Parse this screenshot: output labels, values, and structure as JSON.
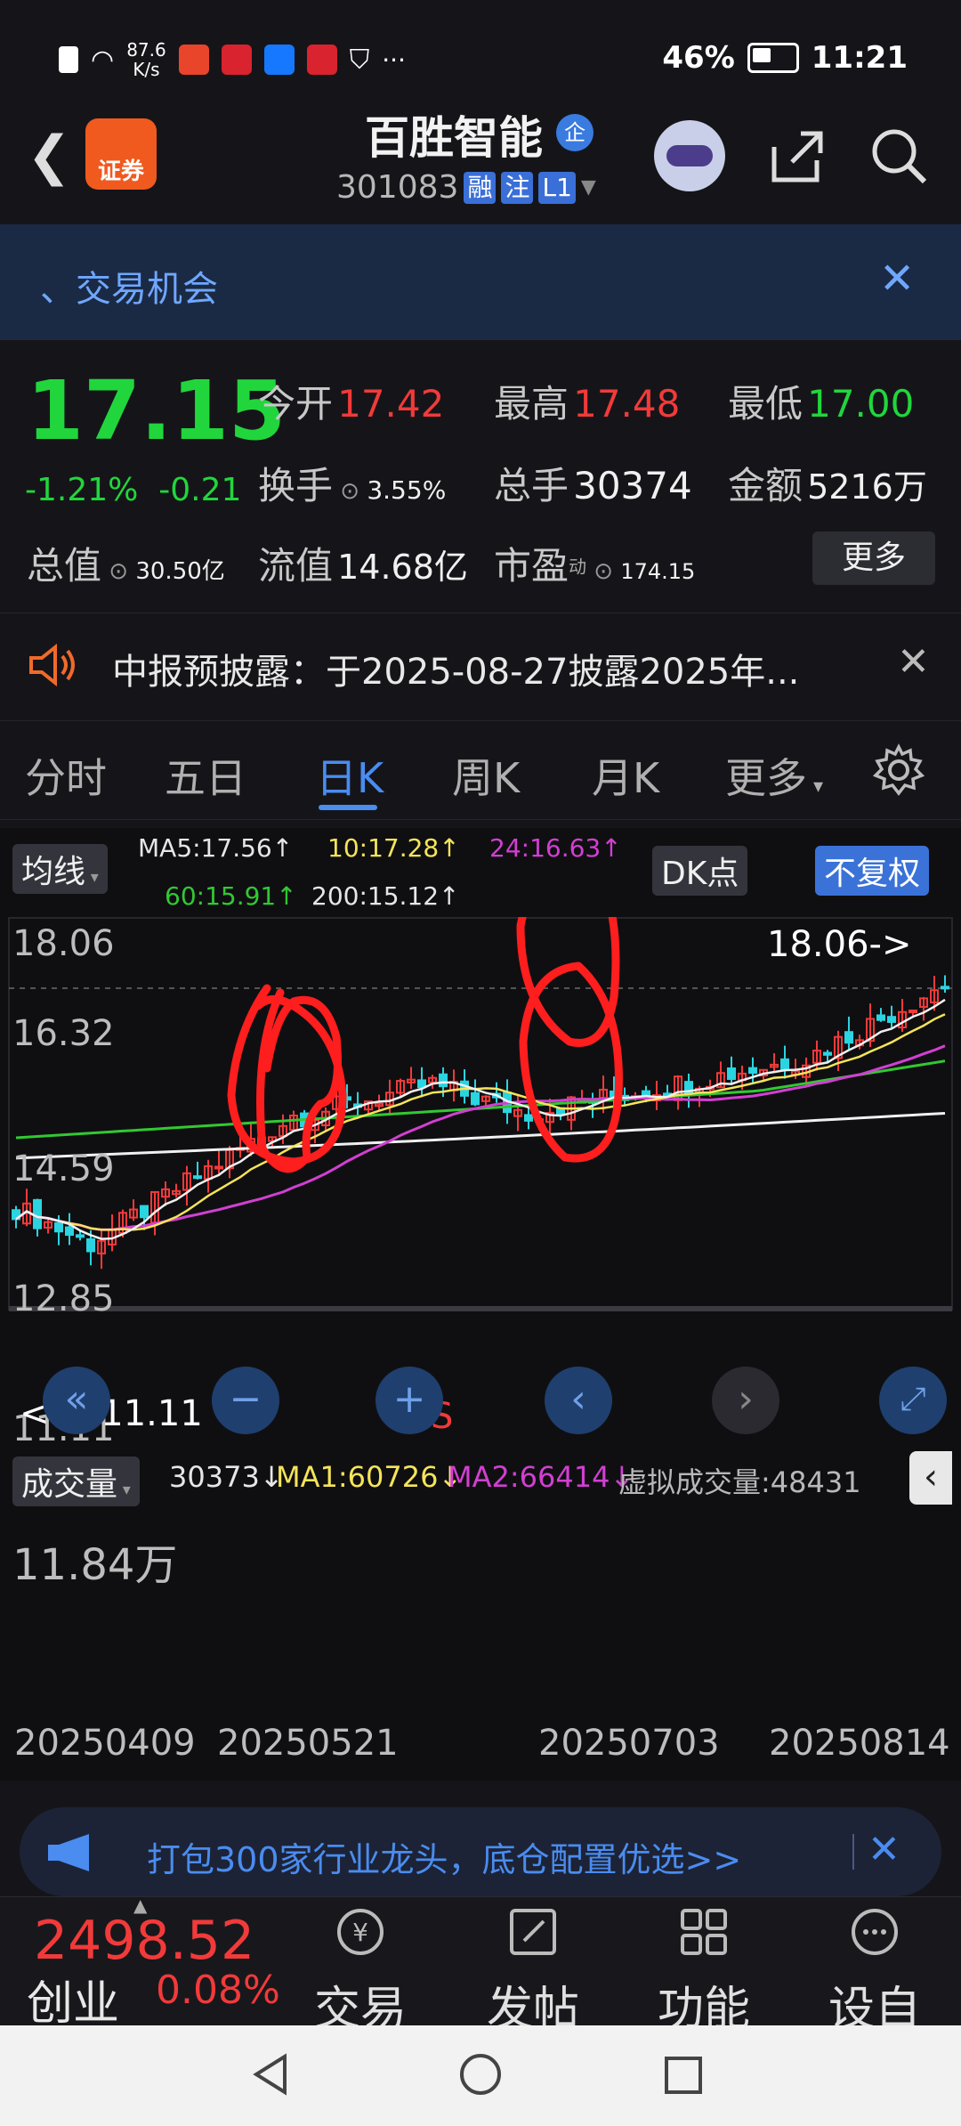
{
  "status_bar": {
    "net_speed": "87.6",
    "net_unit": "K/s",
    "battery": "46%",
    "time": "11:21",
    "more": "···"
  },
  "header": {
    "logo_text": "证券",
    "stock_name": "百胜智能",
    "badge": "企",
    "code": "301083",
    "tags": [
      "融",
      "注",
      "L1"
    ]
  },
  "opportunity": {
    "text": "、交易机会"
  },
  "quote": {
    "price": "17.15",
    "change_pct": "-1.21%",
    "change": "-0.21",
    "fields": [
      {
        "label": "今开",
        "value": "17.42",
        "color": "#f23a3a"
      },
      {
        "label": "最高",
        "value": "17.48",
        "color": "#f23a3a"
      },
      {
        "label": "最低",
        "value": "17.00",
        "color": "#21d63c"
      },
      {
        "label": "换手",
        "value": "3.55%",
        "color": "#f0f0f0"
      },
      {
        "label": "总手",
        "value": "30374",
        "color": "#f0f0f0"
      },
      {
        "label": "金额",
        "value": "5216万",
        "color": "#f0f0f0"
      },
      {
        "label": "总值",
        "value": "30.50亿",
        "color": "#f0f0f0"
      },
      {
        "label": "流值",
        "value": "14.68亿",
        "color": "#f0f0f0"
      },
      {
        "label": "市盈",
        "value": "174.15",
        "color": "#f0f0f0",
        "sup": "动"
      }
    ],
    "more_label": "更多"
  },
  "notice": {
    "text": "中报预披露：于2025-08-27披露2025年..."
  },
  "tabs": [
    "分时",
    "五日",
    "日K",
    "周K",
    "月K",
    "更多"
  ],
  "active_tab": "日K",
  "chart": {
    "ma_toggle": "均线",
    "ma_legend": [
      {
        "text": "MA5:17.56↑",
        "color": "#f0f0f0"
      },
      {
        "text": "10:17.28↑",
        "color": "#f5e45a"
      },
      {
        "text": "24:16.63↑",
        "color": "#d23fd2"
      },
      {
        "text": "60:15.91↑",
        "color": "#32c832"
      },
      {
        "text": "200:15.12↑",
        "color": "#f0f0f0"
      }
    ],
    "dk_label": "DK点",
    "adjust_label": "不复权",
    "y_labels": [
      "18.06",
      "16.32",
      "14.59",
      "12.85",
      "11.11"
    ],
    "max_marker": "18.06->",
    "min_marker": "<----11.11",
    "s_marker": "S",
    "volume_toggle": "成交量",
    "volume_legend": [
      {
        "text": "30373↓",
        "color": "#f0f0f0"
      },
      {
        "text": "MA1:60726↓",
        "color": "#f5e45a"
      },
      {
        "text": "MA2:66414↓",
        "color": "#d23fd2"
      },
      {
        "text": "虚拟成交量:48431",
        "color": "#b8b8b8"
      }
    ],
    "volume_max": "11.84万",
    "dates": [
      "20250409",
      "20250521",
      "20250703",
      "20250814"
    ]
  },
  "banner": {
    "text": "打包300家行业龙头，底仓配置优选>>"
  },
  "bottom": {
    "index_value": "2498.52",
    "index_name": "创业",
    "index_change": "0.08%",
    "nav": [
      "交易",
      "发帖",
      "功能",
      "设自选"
    ]
  }
}
